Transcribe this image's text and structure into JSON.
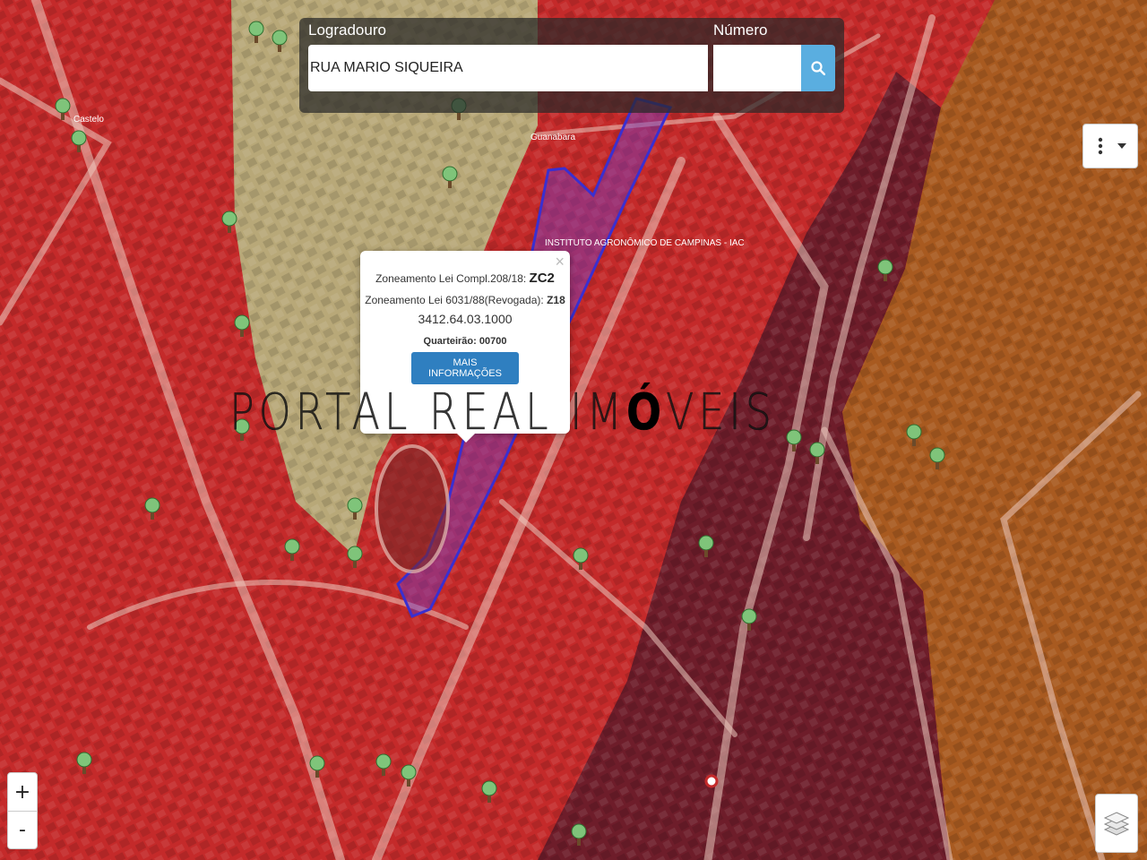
{
  "search": {
    "street_label": "Logradouro",
    "number_label": "Número",
    "street_value": "RUA MARIO SIQUEIRA",
    "number_value": ""
  },
  "popup": {
    "zoning_new_label": "Zoneamento Lei Compl.208/18:",
    "zoning_new_value": "ZC2",
    "zoning_old_label": "Zoneamento Lei 6031/88(Revogada):",
    "zoning_old_value": "Z18",
    "parcel_code": "3412.64.03.1000",
    "block_label": "Quarteirão:",
    "block_value": "00700",
    "more_button": "MAIS INFORMAÇÕES",
    "close": "×"
  },
  "watermark": {
    "part1": "PORTAL REAL IM",
    "accent": "Ó",
    "part2": "VEIS"
  },
  "map_labels": {
    "castelo": "Castelo",
    "guanabara": "Guanabara",
    "institute": "INSTITUTO AGRONÔMICO DE CAMPINAS - IAC"
  },
  "controls": {
    "zoom_in": "+",
    "zoom_out": "-"
  },
  "colors": {
    "zone_red": "#c42a2a",
    "zone_dark": "#6e1d2a",
    "zone_orange": "#a85a20",
    "zone_beige": "#b8a878",
    "parcel_outline": "#3a2fd0",
    "search_button": "#5aaee0",
    "more_button": "#2f7fc0"
  },
  "icons": [
    "tree-icon",
    "search-icon",
    "kebab-menu-icon",
    "caret-down-icon",
    "layers-icon",
    "close-icon"
  ]
}
